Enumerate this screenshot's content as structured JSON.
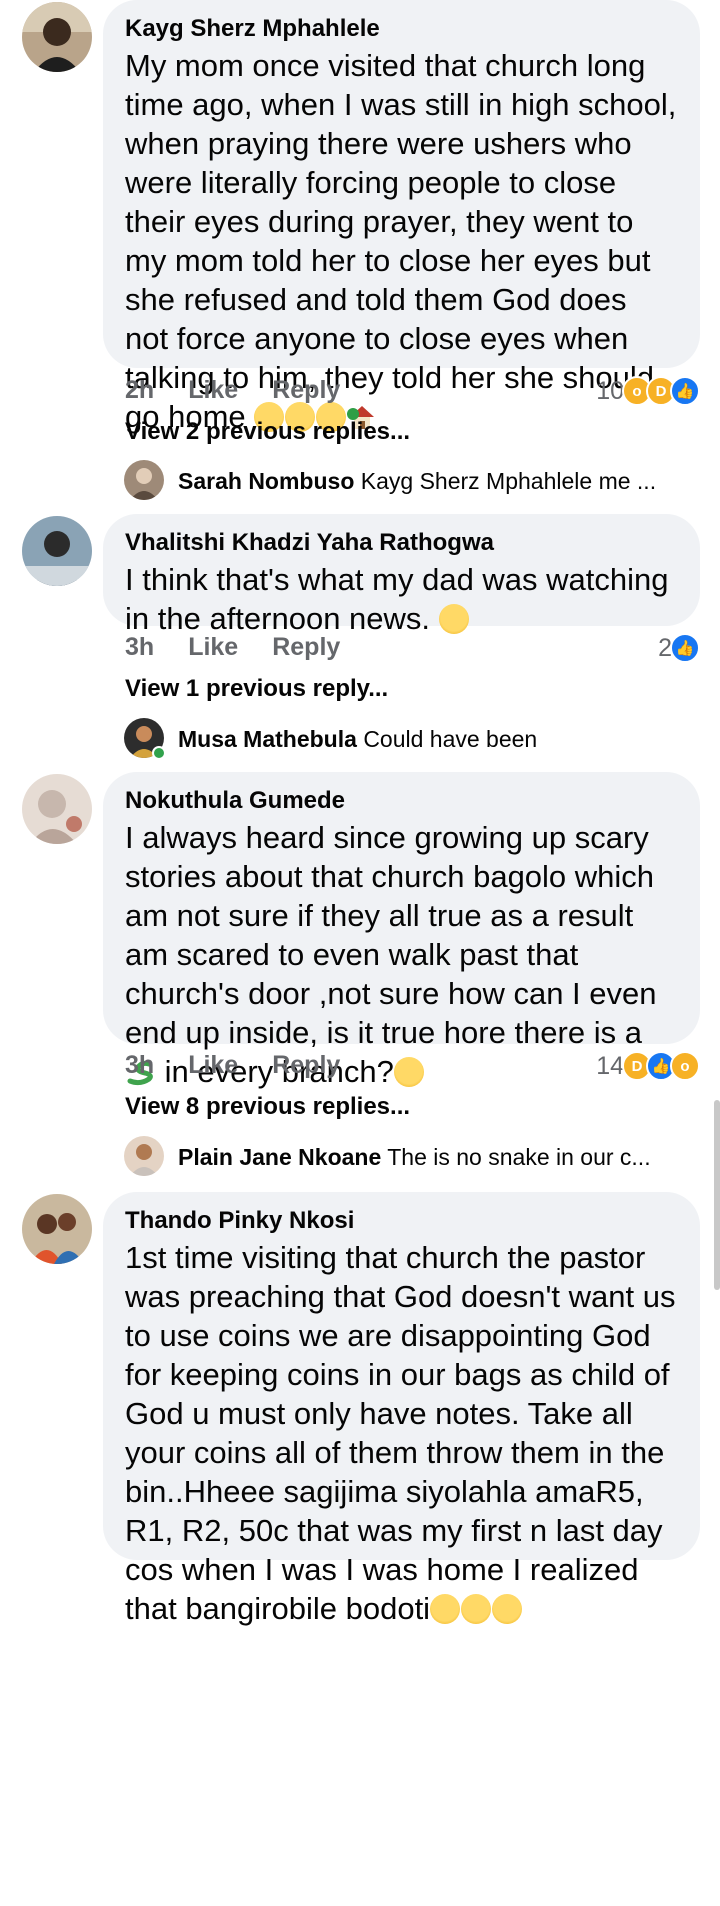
{
  "comments": [
    {
      "author": "Kayg Sherz Mphahlele",
      "text": "My mom once visited that church long time ago, when I was still in high school, when praying there were ushers who were literally forcing people to close their eyes during prayer, they went to my mom told her to close her eyes but she refused and told them God does not force anyone to close eyes when talking to him, they told her she should go home",
      "time": "2h",
      "like_label": "Like",
      "reply_label": "Reply",
      "reaction_count": "10",
      "reactions": [
        "wow",
        "haha",
        "like"
      ],
      "view_replies": "View 2 previous replies...",
      "latest_reply": {
        "author": "Sarah Nombuso",
        "text": "Kayg Sherz Mphahlele me ..."
      }
    },
    {
      "author": "Vhalitshi Khadzi Yaha Rathogwa",
      "text": "I think that's what my dad was watching in the afternoon news.",
      "time": "3h",
      "like_label": "Like",
      "reply_label": "Reply",
      "reaction_count": "2",
      "reactions": [
        "like"
      ],
      "view_replies": "View 1 previous reply...",
      "latest_reply": {
        "author": "Musa Mathebula",
        "text": "Could have been"
      }
    },
    {
      "author": "Nokuthula Gumede",
      "text": "I always heard since growing up scary stories about that church bagolo which am not sure if they all true as a result am scared to even walk past that church's door ,not sure how can I even end up inside, is it true hore there is a",
      "text_tail": "in every branch?",
      "time": "3h",
      "like_label": "Like",
      "reply_label": "Reply",
      "reaction_count": "14",
      "reactions": [
        "haha",
        "like",
        "wow"
      ],
      "view_replies": "View 8 previous replies...",
      "latest_reply": {
        "author": "Plain Jane Nkoane",
        "text": "The is no snake in our c..."
      }
    },
    {
      "author": "Thando Pinky Nkosi",
      "text": "1st time visiting that church the pastor was preaching that God doesn't want us to use coins we are disappointing God for keeping coins in our bags as child of God u must only have notes. Take all your coins all of them throw them in the bin..Hheee sagijima siyolahla amaR5, R1, R2, 50c that was my first n last day cos when I was I was home I realized that bangirobile bodoti"
    }
  ],
  "colors": {
    "bubble": "#f0f2f5",
    "meta_text": "#65676b",
    "like_blue": "#1877f2",
    "emoji_yellow": "#f7b125",
    "online_green": "#31a24c"
  }
}
